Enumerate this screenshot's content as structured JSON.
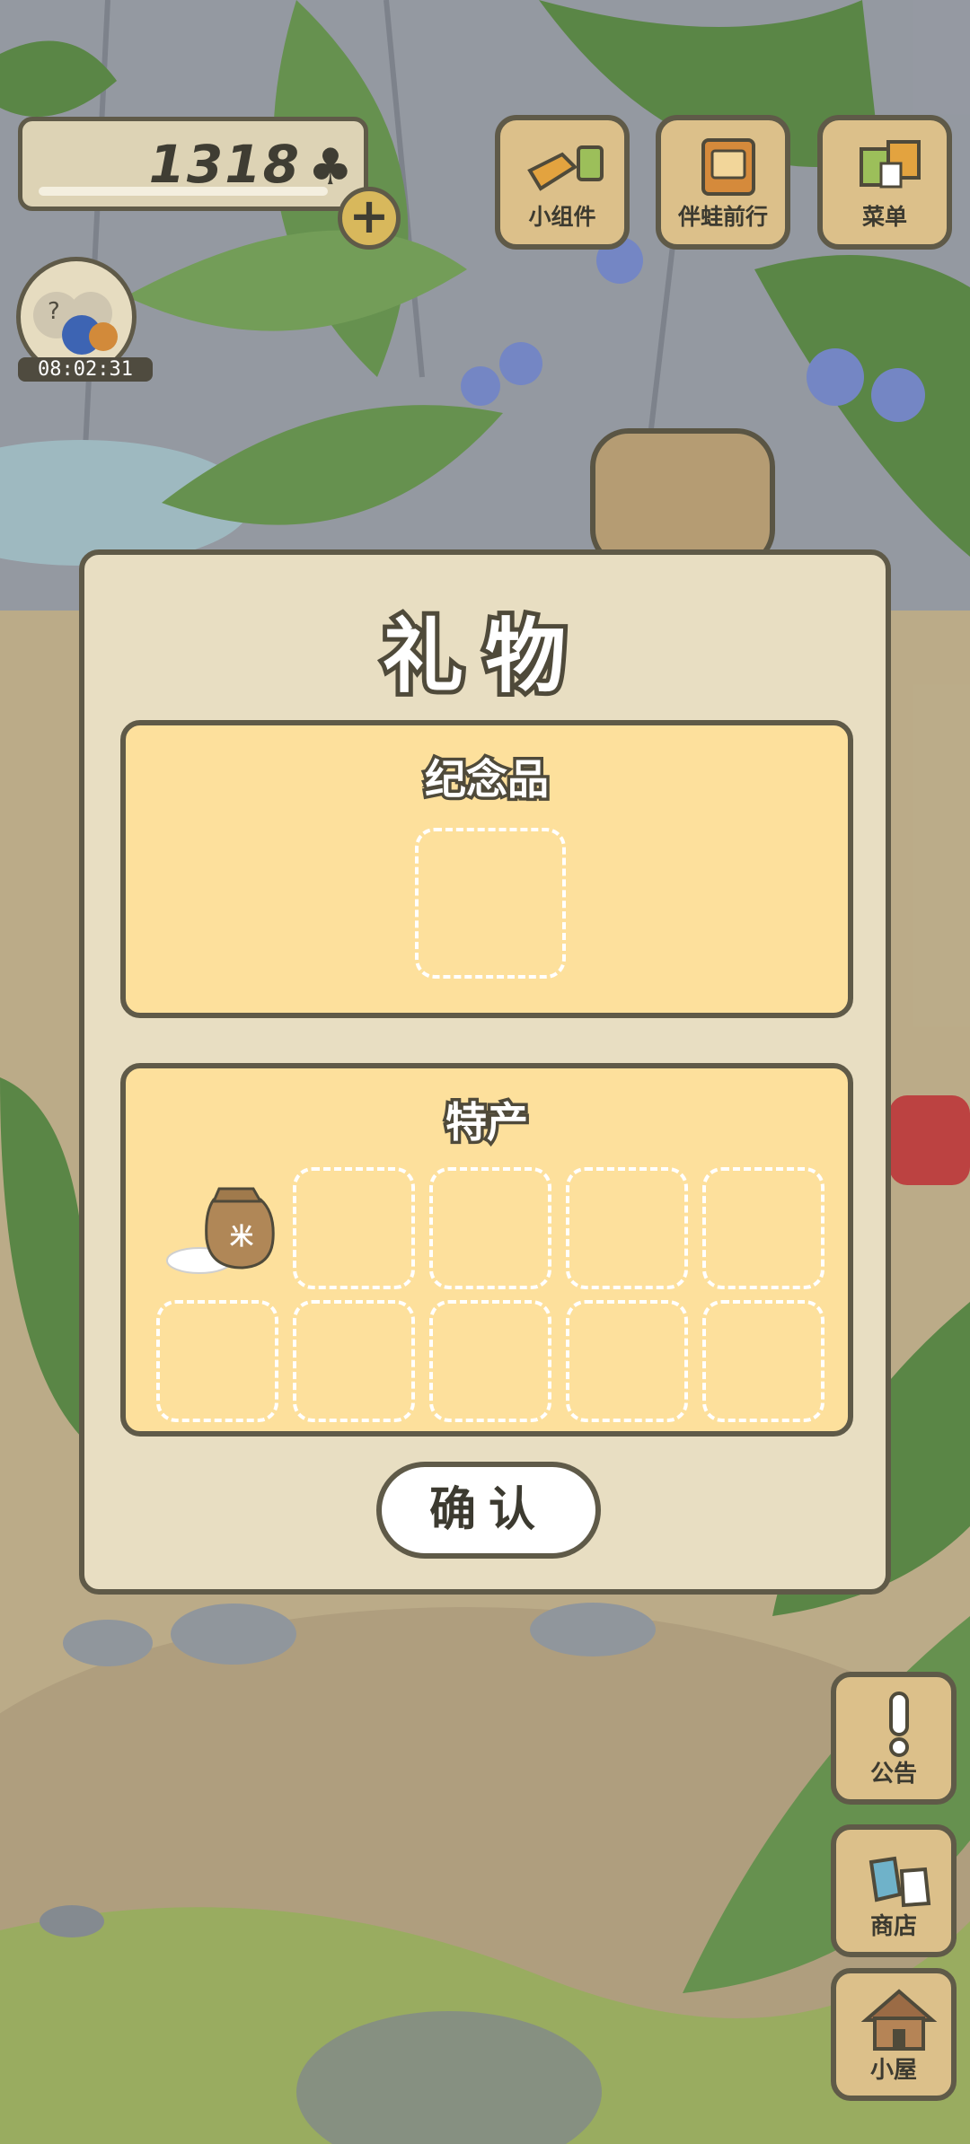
{
  "clover": {
    "count": "1318",
    "icon": "clover-icon",
    "add_icon": "plus-icon"
  },
  "timer": {
    "time": "08:02:31"
  },
  "top_buttons": [
    {
      "label": "小组件",
      "icon": "widget-icon"
    },
    {
      "label": "伴蛙前行",
      "icon": "journey-album-icon"
    },
    {
      "label": "菜单",
      "icon": "menu-cards-icon"
    }
  ],
  "side_buttons": [
    {
      "label": "公告",
      "icon": "exclamation-icon"
    },
    {
      "label": "商店",
      "icon": "shop-bags-icon"
    },
    {
      "label": "小屋",
      "icon": "house-icon"
    }
  ],
  "dialog": {
    "title": "礼物",
    "souvenir": {
      "title": "纪念品",
      "slots": 1
    },
    "specialty": {
      "title": "特产",
      "items": [
        {
          "icon": "rice-bag-icon",
          "label": "米"
        }
      ],
      "empty_slots": 9
    },
    "confirm_label": "确认"
  },
  "colors": {
    "outline": "#5f5a48",
    "panel_fill": "#fde09c",
    "dialog_fill": "#e8dec2",
    "wood": "#dcc08a"
  }
}
